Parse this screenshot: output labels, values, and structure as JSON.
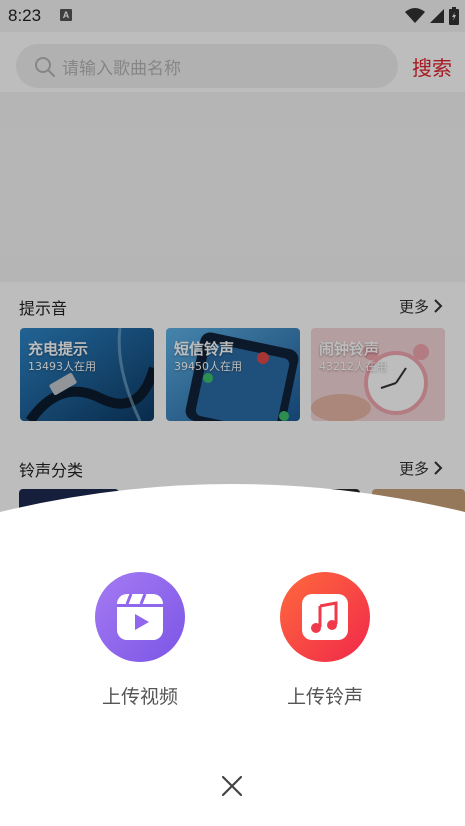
{
  "status_bar": {
    "time": "8:23",
    "notification_badge": "A",
    "icons": [
      "wifi-icon",
      "cellular-signal-icon",
      "battery-icon"
    ]
  },
  "search": {
    "placeholder": "请输入歌曲名称",
    "button_label": "搜索"
  },
  "sections": {
    "tones": {
      "title": "提示音",
      "more_label": "更多",
      "cards": [
        {
          "title": "充电提示",
          "subtitle": "13493人在用"
        },
        {
          "title": "短信铃声",
          "subtitle": "39450人在用"
        },
        {
          "title": "闹钟铃声",
          "subtitle": "43212人在用"
        }
      ]
    },
    "categories": {
      "title": "铃声分类",
      "more_label": "更多"
    }
  },
  "sheet": {
    "actions": [
      {
        "label": "上传视频",
        "icon": "video-reel-icon"
      },
      {
        "label": "上传铃声",
        "icon": "music-note-icon"
      }
    ],
    "close_icon": "close-icon"
  },
  "colors": {
    "accent_red": "#e1252f",
    "upload_video_gradient": [
      "#a57bf2",
      "#7b55e6"
    ],
    "upload_ringtone_gradient": [
      "#ff6a3d",
      "#f0284a"
    ]
  }
}
